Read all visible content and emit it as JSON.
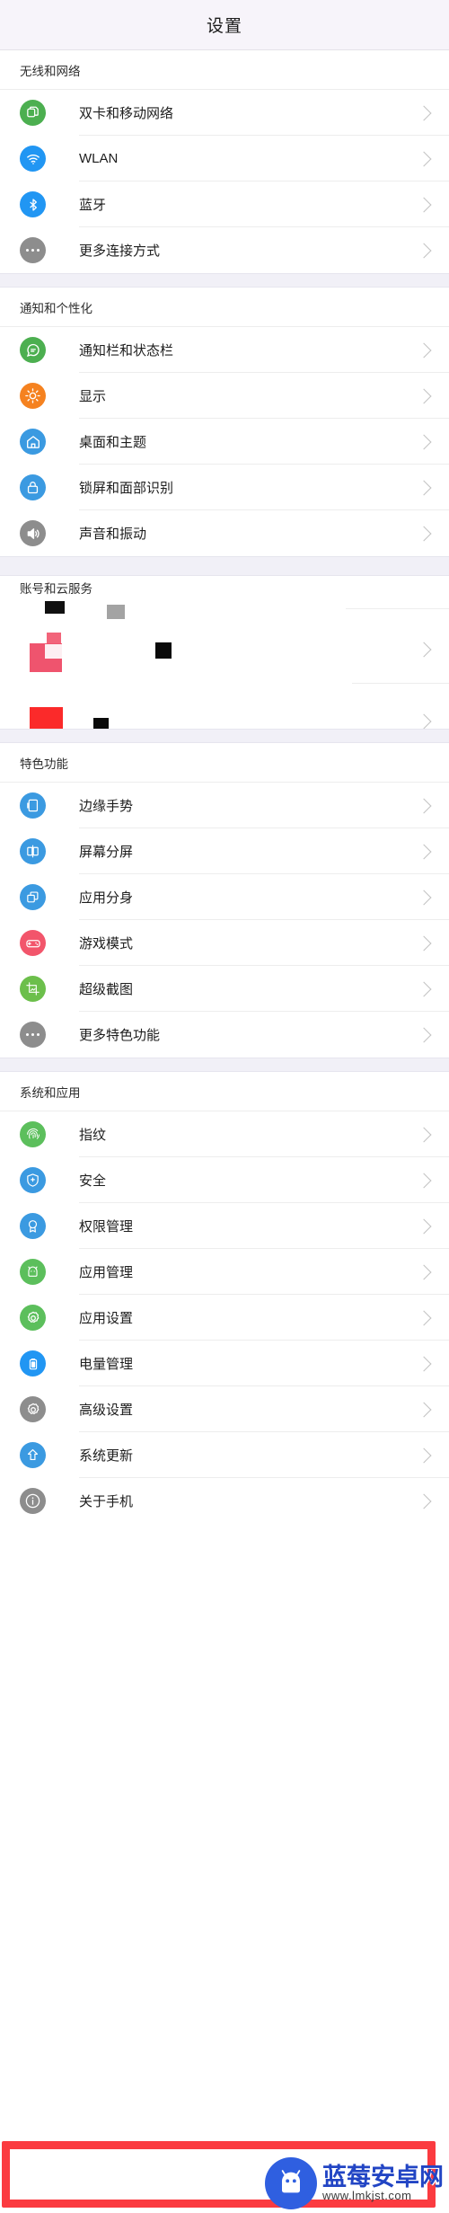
{
  "header": {
    "title": "设置"
  },
  "watermark": {
    "site_name": "蓝莓安卓网",
    "url": "www.lmkjst.com",
    "logo_icon": "android-mascot-icon"
  },
  "highlight": {
    "color": "#fb3b40",
    "target_row": "关于手机"
  },
  "sections": [
    {
      "id": "wireless",
      "title": "无线和网络",
      "items": [
        {
          "label": "双卡和移动网络",
          "icon": "sim-card-icon",
          "color": "#4caf50"
        },
        {
          "label": "WLAN",
          "icon": "wifi-icon",
          "color": "#2196f3"
        },
        {
          "label": "蓝牙",
          "icon": "bluetooth-icon",
          "color": "#2196f3"
        },
        {
          "label": "更多连接方式",
          "icon": "more-dots-icon",
          "color": "#8d8d8d"
        }
      ]
    },
    {
      "id": "notification",
      "title": "通知和个性化",
      "items": [
        {
          "label": "通知栏和状态栏",
          "icon": "chat-bubble-icon",
          "color": "#4caf50"
        },
        {
          "label": "显示",
          "icon": "brightness-icon",
          "color": "#f58220"
        },
        {
          "label": "桌面和主题",
          "icon": "home-icon",
          "color": "#3b9ae1"
        },
        {
          "label": "锁屏和面部识别",
          "icon": "lock-icon",
          "color": "#3b9ae1"
        },
        {
          "label": "声音和振动",
          "icon": "speaker-icon",
          "color": "#8d8d8d"
        }
      ]
    },
    {
      "id": "account",
      "title": "账号和云服务",
      "corrupted": true,
      "items": [
        {
          "label": "",
          "icon": "corrupted-icon",
          "color": "#f2647a"
        },
        {
          "label": "",
          "icon": "corrupted-icon",
          "color": "#fb2a2a"
        }
      ]
    },
    {
      "id": "features",
      "title": "特色功能",
      "items": [
        {
          "label": "边缘手势",
          "icon": "edge-gesture-icon",
          "color": "#3b9ae1"
        },
        {
          "label": "屏幕分屏",
          "icon": "split-screen-icon",
          "color": "#3b9ae1"
        },
        {
          "label": "应用分身",
          "icon": "app-clone-icon",
          "color": "#3b9ae1"
        },
        {
          "label": "游戏模式",
          "icon": "gamepad-icon",
          "color": "#f2556b"
        },
        {
          "label": "超级截图",
          "icon": "screenshot-icon",
          "color": "#6cbf4b"
        },
        {
          "label": "更多特色功能",
          "icon": "more-dots-icon",
          "color": "#8d8d8d"
        }
      ]
    },
    {
      "id": "system",
      "title": "系统和应用",
      "items": [
        {
          "label": "指纹",
          "icon": "fingerprint-icon",
          "color": "#5cbf5c"
        },
        {
          "label": "安全",
          "icon": "shield-icon",
          "color": "#3b9ae1"
        },
        {
          "label": "权限管理",
          "icon": "badge-icon",
          "color": "#3b9ae1"
        },
        {
          "label": "应用管理",
          "icon": "android-icon",
          "color": "#5cbf5c"
        },
        {
          "label": "应用设置",
          "icon": "gear-icon",
          "color": "#5cbf5c"
        },
        {
          "label": "电量管理",
          "icon": "battery-icon",
          "color": "#2196f3"
        },
        {
          "label": "高级设置",
          "icon": "gear-icon",
          "color": "#8d8d8d"
        },
        {
          "label": "系统更新",
          "icon": "upload-arrow-icon",
          "color": "#3b9ae1"
        },
        {
          "label": "关于手机",
          "icon": "info-icon",
          "color": "#8d8d8d"
        }
      ]
    }
  ]
}
